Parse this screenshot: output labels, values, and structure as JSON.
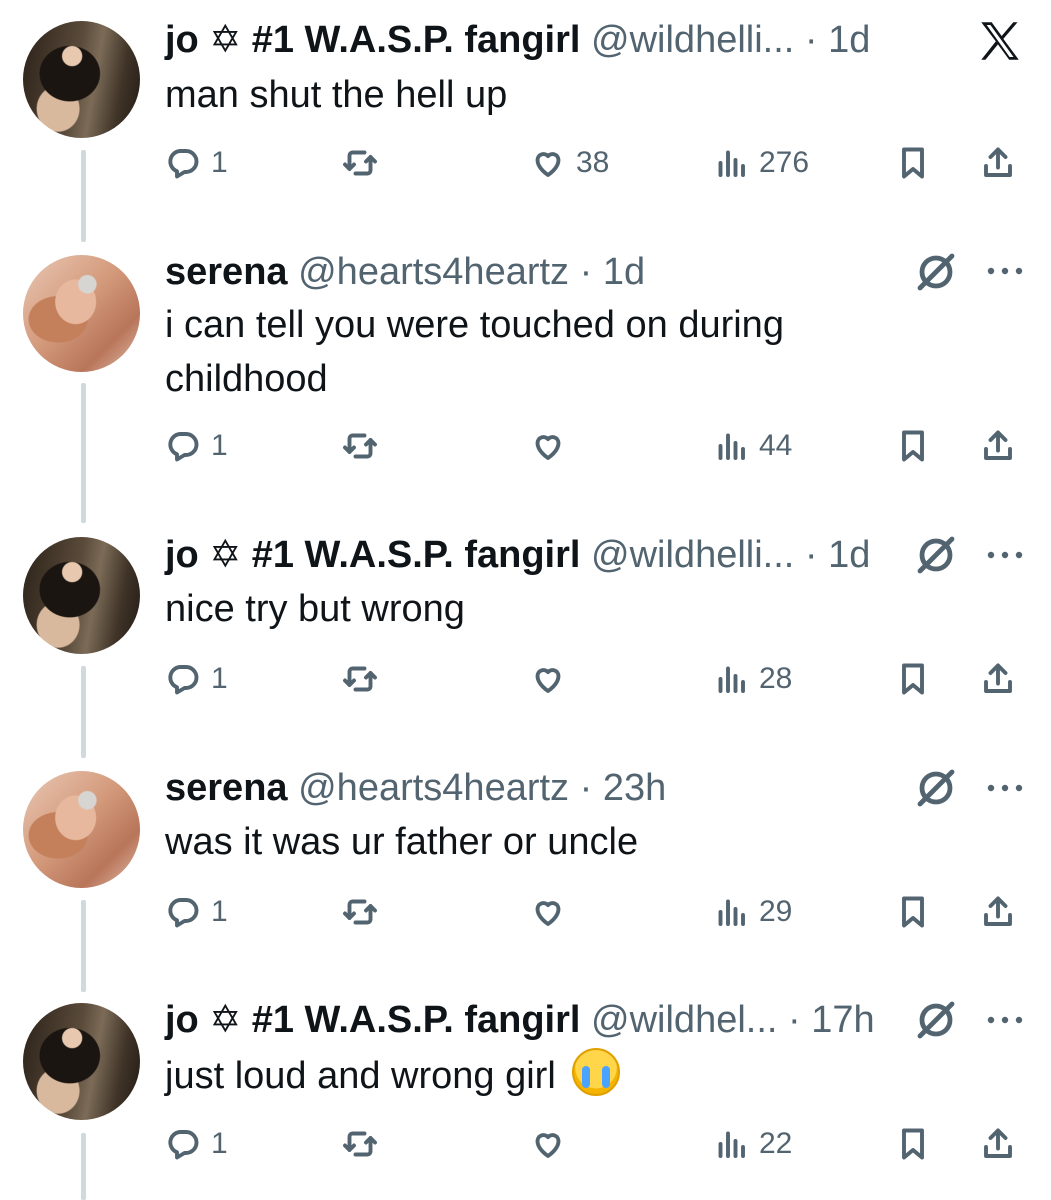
{
  "tweets": [
    {
      "name": "jo ✡ #1 W.A.S.P. fangirl",
      "handle": "@wildhelli...",
      "time": "1d",
      "text": "man shut the hell up",
      "replies": "1",
      "likes": "38",
      "views": "276",
      "avatar": "jo-avatar"
    },
    {
      "name": "serena",
      "handle": "@hearts4heartz",
      "time": "1d",
      "text": "i can tell you were touched on during childhood",
      "replies": "1",
      "likes": "",
      "views": "44",
      "avatar": "serena-avatar"
    },
    {
      "name": "jo ✡ #1 W.A.S.P. fangirl",
      "handle": "@wildhelli...",
      "time": "1d",
      "text": "nice try but wrong",
      "replies": "1",
      "likes": "",
      "views": "28",
      "avatar": "jo-avatar"
    },
    {
      "name": "serena",
      "handle": "@hearts4heartz",
      "time": "23h",
      "text": "was it was ur father or uncle",
      "replies": "1",
      "likes": "",
      "views": "29",
      "avatar": "serena-avatar"
    },
    {
      "name": "jo ✡ #1 W.A.S.P. fangirl",
      "handle": "@wildhel...",
      "time": "17h",
      "text": "just loud and wrong girl",
      "emoji": "loudly-crying-face",
      "replies": "1",
      "likes": "",
      "views": "22",
      "avatar": "jo-avatar"
    }
  ],
  "separator": "·",
  "icons": {
    "reply": "reply-icon",
    "retweet": "retweet-icon",
    "like": "heart-icon",
    "views": "views-icon",
    "bookmark": "bookmark-icon",
    "share": "share-icon",
    "grok": "grok-icon",
    "more": "more-icon",
    "x_logo": "x-logo-icon"
  },
  "colors": {
    "text": "#0f1419",
    "secondary": "#536471",
    "thread_line": "#cfd9de"
  }
}
